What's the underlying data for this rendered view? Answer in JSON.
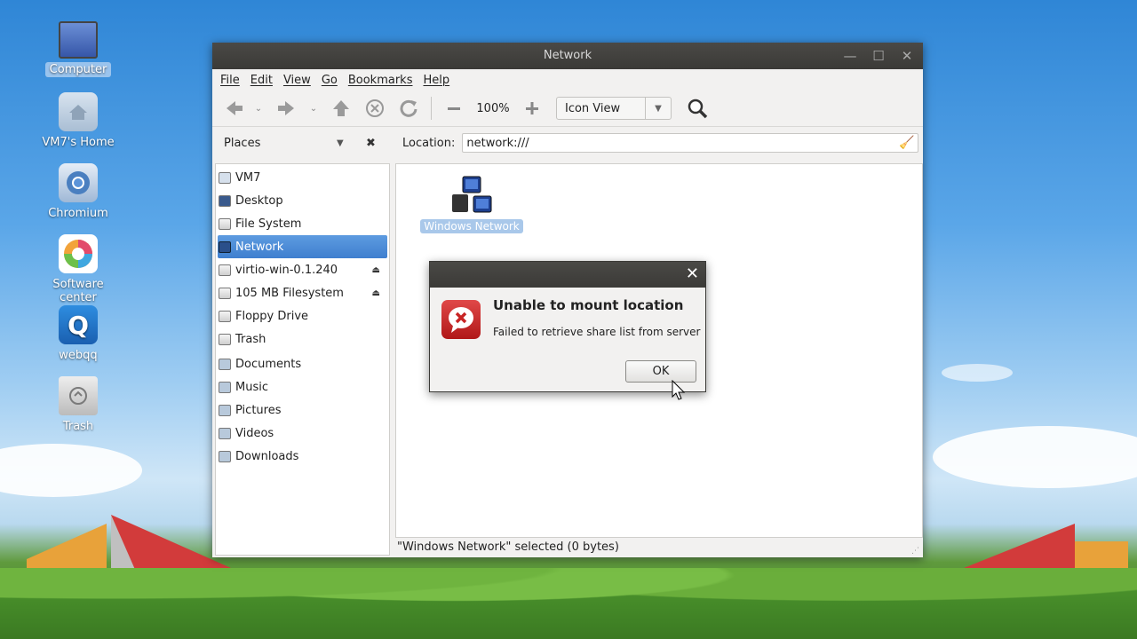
{
  "desktop": {
    "icons": [
      {
        "label": "Computer",
        "icon": "computer-icon",
        "selected": true
      },
      {
        "label": "VM7's Home",
        "icon": "home-folder-icon"
      },
      {
        "label": "Chromium",
        "icon": "chromium-icon"
      },
      {
        "label": "Software center",
        "icon": "software-center-icon"
      },
      {
        "label": "webqq",
        "icon": "webqq-icon"
      },
      {
        "label": "Trash",
        "icon": "trash-icon"
      }
    ]
  },
  "window": {
    "title": "Network",
    "menu": [
      "File",
      "Edit",
      "View",
      "Go",
      "Bookmarks",
      "Help"
    ],
    "toolbar": {
      "zoom": "100%",
      "view_mode": "Icon View"
    },
    "places_label": "Places",
    "location_label": "Location:",
    "location_value": "network:///",
    "sidebar": [
      {
        "label": "VM7",
        "icon": "home-icon"
      },
      {
        "label": "Desktop",
        "icon": "desktop-icon"
      },
      {
        "label": "File System",
        "icon": "drive-icon"
      },
      {
        "label": "Network",
        "icon": "network-icon",
        "selected": true
      },
      {
        "label": "virtio-win-0.1.240",
        "icon": "disc-icon",
        "eject": true
      },
      {
        "label": "105 MB Filesystem",
        "icon": "drive-icon",
        "eject": true
      },
      {
        "label": "Floppy Drive",
        "icon": "floppy-icon"
      },
      {
        "label": "Trash",
        "icon": "trash-icon"
      },
      {
        "label": "Documents",
        "icon": "folder-icon"
      },
      {
        "label": "Music",
        "icon": "folder-icon"
      },
      {
        "label": "Pictures",
        "icon": "folder-icon"
      },
      {
        "label": "Videos",
        "icon": "folder-icon"
      },
      {
        "label": "Downloads",
        "icon": "folder-icon"
      }
    ],
    "items": [
      {
        "label": "Windows Network",
        "icon": "windows-network-icon",
        "selected": true
      }
    ],
    "status": "\"Windows Network\" selected (0 bytes)"
  },
  "dialog": {
    "heading": "Unable to mount location",
    "message": "Failed to retrieve share list from server",
    "ok_label": "OK"
  },
  "colors": {
    "titlebar": "#3b3a37",
    "selection": "#4a88d4",
    "error_icon": "#c82424"
  }
}
